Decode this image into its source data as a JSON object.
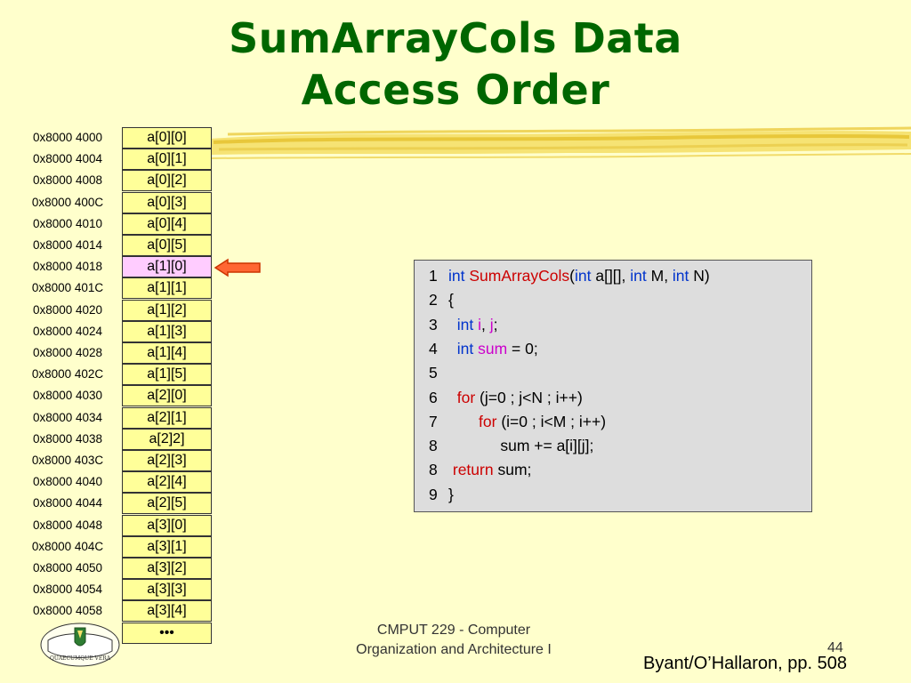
{
  "title": {
    "line1": "SumArrayCols Data",
    "line2": "Access Order"
  },
  "memory": {
    "rows": [
      {
        "addr": "0x8000 4000",
        "cell": "a[0][0]"
      },
      {
        "addr": "0x8000 4004",
        "cell": "a[0][1]"
      },
      {
        "addr": "0x8000 4008",
        "cell": "a[0][2]"
      },
      {
        "addr": "0x8000 400C",
        "cell": "a[0][3]"
      },
      {
        "addr": "0x8000 4010",
        "cell": "a[0][4]"
      },
      {
        "addr": "0x8000 4014",
        "cell": "a[0][5]"
      },
      {
        "addr": "0x8000 4018",
        "cell": "a[1][0]",
        "highlight": true
      },
      {
        "addr": "0x8000 401C",
        "cell": "a[1][1]"
      },
      {
        "addr": "0x8000 4020",
        "cell": "a[1][2]"
      },
      {
        "addr": "0x8000 4024",
        "cell": "a[1][3]"
      },
      {
        "addr": "0x8000 4028",
        "cell": "a[1][4]"
      },
      {
        "addr": "0x8000 402C",
        "cell": "a[1][5]"
      },
      {
        "addr": "0x8000 4030",
        "cell": "a[2][0]"
      },
      {
        "addr": "0x8000 4034",
        "cell": "a[2][1]"
      },
      {
        "addr": "0x8000 4038",
        "cell": "a[2]2]"
      },
      {
        "addr": "0x8000 403C",
        "cell": "a[2][3]"
      },
      {
        "addr": "0x8000 4040",
        "cell": "a[2][4]"
      },
      {
        "addr": "0x8000 4044",
        "cell": "a[2][5]"
      },
      {
        "addr": "0x8000 4048",
        "cell": "a[3][0]"
      },
      {
        "addr": "0x8000 404C",
        "cell": "a[3][1]"
      },
      {
        "addr": "0x8000 4050",
        "cell": "a[3][2]"
      },
      {
        "addr": "0x8000 4054",
        "cell": "a[3][3]"
      },
      {
        "addr": "0x8000 4058",
        "cell": "a[3][4]"
      },
      {
        "addr": "",
        "cell": "•••"
      }
    ]
  },
  "code": {
    "lines": [
      {
        "num": "1",
        "tokens": [
          {
            "t": "int",
            "c": "kw-blue"
          },
          {
            "t": " "
          },
          {
            "t": "SumArrayCols",
            "c": "kw-red"
          },
          {
            "t": "("
          },
          {
            "t": "int",
            "c": "kw-blue"
          },
          {
            "t": " a[][], "
          },
          {
            "t": "int",
            "c": "kw-blue"
          },
          {
            "t": " M, "
          },
          {
            "t": "int",
            "c": "kw-blue"
          },
          {
            "t": " N)"
          }
        ]
      },
      {
        "num": "2",
        "tokens": [
          {
            "t": "{"
          }
        ]
      },
      {
        "num": "3",
        "tokens": [
          {
            "t": "  "
          },
          {
            "t": "int",
            "c": "kw-blue"
          },
          {
            "t": " "
          },
          {
            "t": "i",
            "c": "kw-mag"
          },
          {
            "t": ", "
          },
          {
            "t": "j",
            "c": "kw-mag"
          },
          {
            "t": ";"
          }
        ]
      },
      {
        "num": "4",
        "tokens": [
          {
            "t": "  "
          },
          {
            "t": "int",
            "c": "kw-blue"
          },
          {
            "t": " "
          },
          {
            "t": "sum",
            "c": "kw-mag"
          },
          {
            "t": " = 0;"
          }
        ]
      },
      {
        "num": "5",
        "tokens": []
      },
      {
        "num": "6",
        "tokens": [
          {
            "t": "  "
          },
          {
            "t": "for",
            "c": "kw-red"
          },
          {
            "t": " (j=0 ; j<N ; i++)"
          }
        ]
      },
      {
        "num": "7",
        "tokens": [
          {
            "t": "       "
          },
          {
            "t": "for",
            "c": "kw-red"
          },
          {
            "t": " (i=0 ; i<M ; i++)"
          }
        ]
      },
      {
        "num": "8",
        "tokens": [
          {
            "t": "            sum += a[i][j];"
          }
        ]
      },
      {
        "num": "8",
        "tokens": [
          {
            "t": " "
          },
          {
            "t": "return",
            "c": "kw-red"
          },
          {
            "t": " sum;"
          }
        ]
      },
      {
        "num": "9",
        "tokens": [
          {
            "t": "}"
          }
        ]
      }
    ]
  },
  "footer": {
    "course_line1": "CMPUT 229 - Computer",
    "course_line2": "Organization and Architecture I",
    "page_number": "44",
    "credit": "Byant/O’Hallaron, pp. 508"
  },
  "colors": {
    "background": "#ffffcc",
    "title": "#006600",
    "cell": "#ffff99",
    "cell_highlight": "#ffccff",
    "arrow": "#ff6633",
    "highlighter": "#f2d94a"
  },
  "logo": {
    "text": "QUAECUMQUE VERA",
    "icon": "university-crest-icon"
  }
}
